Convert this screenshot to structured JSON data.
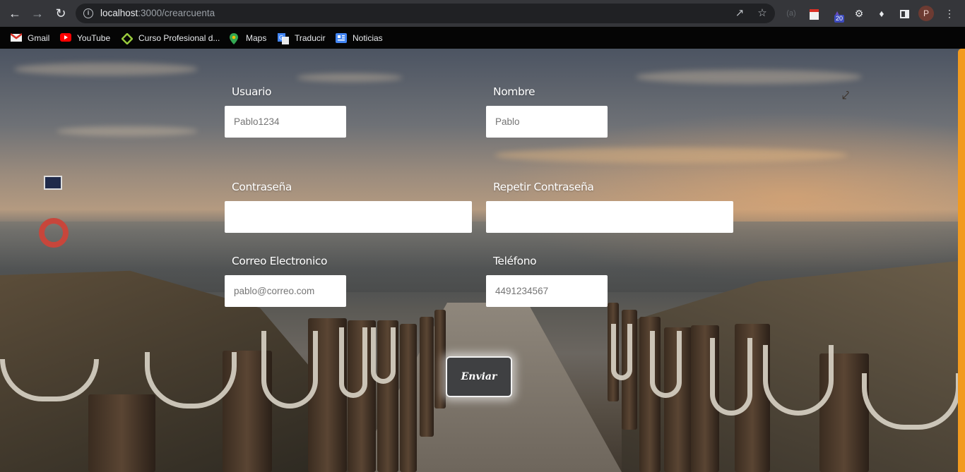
{
  "browser": {
    "url_host": "localhost",
    "url_path": ":3000/crearcuenta",
    "avatar_letter": "P",
    "extension_badge": "20",
    "bookmarks": [
      {
        "label": "Gmail",
        "icon": "gmail-icon"
      },
      {
        "label": "YouTube",
        "icon": "youtube-icon"
      },
      {
        "label": "Curso Profesional d...",
        "icon": "diamond-icon"
      },
      {
        "label": "Maps",
        "icon": "maps-pin-icon"
      },
      {
        "label": "Traducir",
        "icon": "translate-icon"
      },
      {
        "label": "Noticias",
        "icon": "news-icon"
      }
    ]
  },
  "form": {
    "usuario": {
      "label": "Usuario",
      "placeholder": "Pablo1234"
    },
    "nombre": {
      "label": "Nombre",
      "placeholder": "Pablo"
    },
    "contrasena": {
      "label": "Contraseña",
      "placeholder": ""
    },
    "repetir_contrasena": {
      "label": "Repetir Contraseña",
      "placeholder": ""
    },
    "correo": {
      "label": "Correo Electronico",
      "placeholder": "pablo@correo.com"
    },
    "telefono": {
      "label": "Teléfono",
      "placeholder": "4491234567"
    },
    "submit_label": "Enviar"
  },
  "colors": {
    "accent_scrollbar": "#f29a1e",
    "button_bg": "#3f4042",
    "chrome_toolbar": "#35363a"
  }
}
